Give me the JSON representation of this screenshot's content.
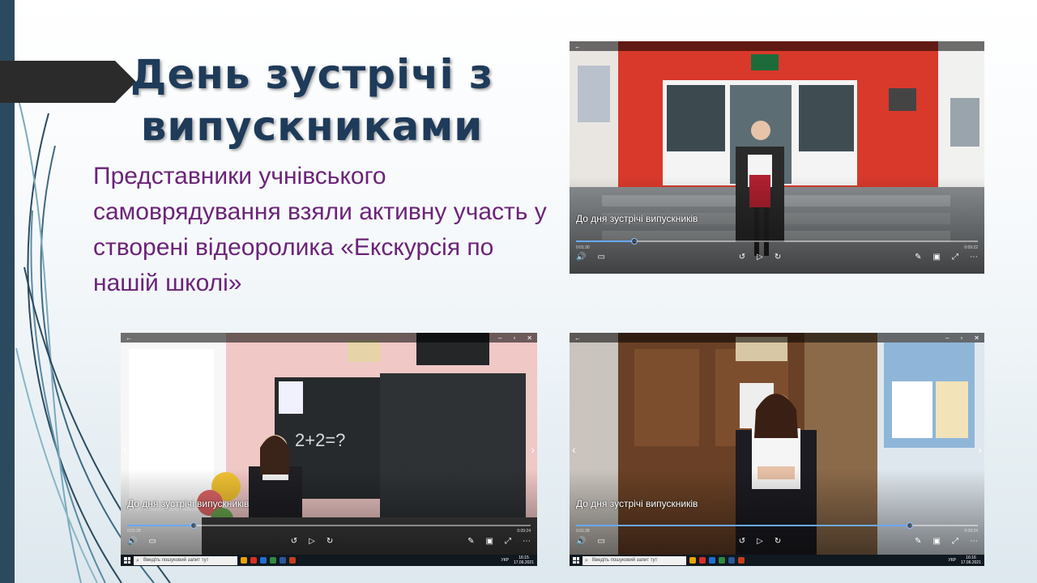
{
  "slide": {
    "title": "День зустрічі з випускниками",
    "subtitle": "Представники учнівського самоврядування взяли активну участь у створені відеоролика «Екскурсія по нашій школі»"
  },
  "videos": [
    {
      "caption": "До дня зустрічі випускників",
      "time_current": "0:01:30",
      "time_total": "0:09:22",
      "progress": 0.145
    },
    {
      "caption": "До дня зустрічі випускників",
      "time_current": "0:01:28",
      "time_total": "0:09:24",
      "progress": 0.165,
      "taskbar": {
        "search_placeholder": "Введіть пошуковий запит тут",
        "lang": "УКР",
        "time": "16:15",
        "date": "17.06.2021"
      }
    },
    {
      "caption": "До дня зустрічі випускників",
      "time_current": "0:01:28",
      "time_total": "0:09:24",
      "progress": 0.83,
      "taskbar": {
        "search_placeholder": "Введіть пошуковий запит тут",
        "lang": "УКР",
        "time": "16:16",
        "date": "17.06.2021"
      }
    }
  ],
  "icons": {
    "back": "back-arrow-icon",
    "volume": "volume-icon",
    "subtitles": "subtitles-icon",
    "rewind": "rewind-icon",
    "play": "play-icon",
    "forward": "forward-icon",
    "edit": "pen-icon",
    "miniplayer": "miniplayer-icon",
    "fullscreen": "fullscreen-icon",
    "more": "more-icon"
  },
  "colors": {
    "title": "#1f3b5a",
    "subtitle": "#6b2478",
    "accent_bar": "#2c4a5e",
    "progress": "#6aa8ff"
  }
}
